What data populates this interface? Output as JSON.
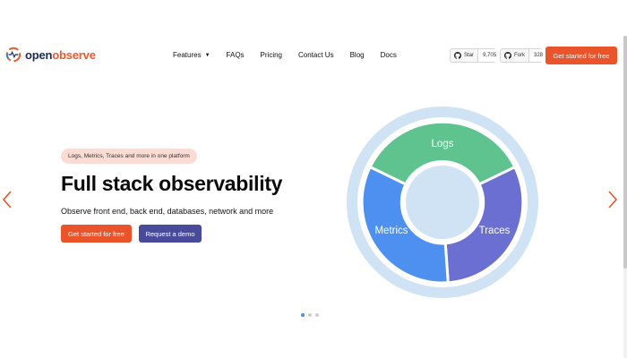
{
  "brand": {
    "name_part1": "open",
    "name_part2": "observe"
  },
  "nav": {
    "features": "Features",
    "faqs": "FAQs",
    "pricing": "Pricing",
    "contact": "Contact Us",
    "blog": "Blog",
    "docs": "Docs"
  },
  "github": {
    "star_label": "Star",
    "star_count": "9,705",
    "fork_label": "Fork",
    "fork_count": "328"
  },
  "header_cta": "Get started for free",
  "hero": {
    "badge": "Logs, Metrics, Traces and more in one platform",
    "title": "Full stack observability",
    "subtitle": "Observe front end, back end, databases, network and more",
    "primary_button": "Get started for free",
    "secondary_button": "Request a demo"
  },
  "wheel": {
    "segments": [
      "Logs",
      "Traces",
      "Metrics"
    ],
    "colors": {
      "logs": "#5ec38e",
      "traces": "#6b6fd1",
      "metrics": "#4e90f0",
      "ring": "#cfe3f5"
    }
  },
  "carousel": {
    "slide_count": 3,
    "active_slide": 1
  },
  "colors": {
    "accent": "#e9542a",
    "secondary": "#4a4a9a"
  }
}
